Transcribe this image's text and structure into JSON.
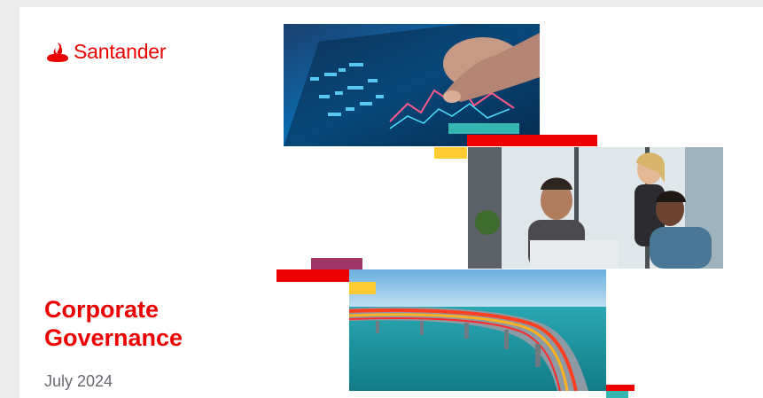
{
  "brand": {
    "name": "Santander",
    "color": "#ec0000"
  },
  "cover": {
    "title": "Corporate Governance",
    "date": "July 2024"
  },
  "images": {
    "tablet": "hand touching tablet with financial charts",
    "meeting": "three colleagues smiling in an office",
    "bridge": "curved bridge over the sea with light trails"
  },
  "colors": {
    "accent_red": "#ec0000",
    "accent_teal": "#33b7b0",
    "accent_yellow": "#ffcc33",
    "accent_purple": "#9e3667",
    "date_gray": "#666a70"
  }
}
